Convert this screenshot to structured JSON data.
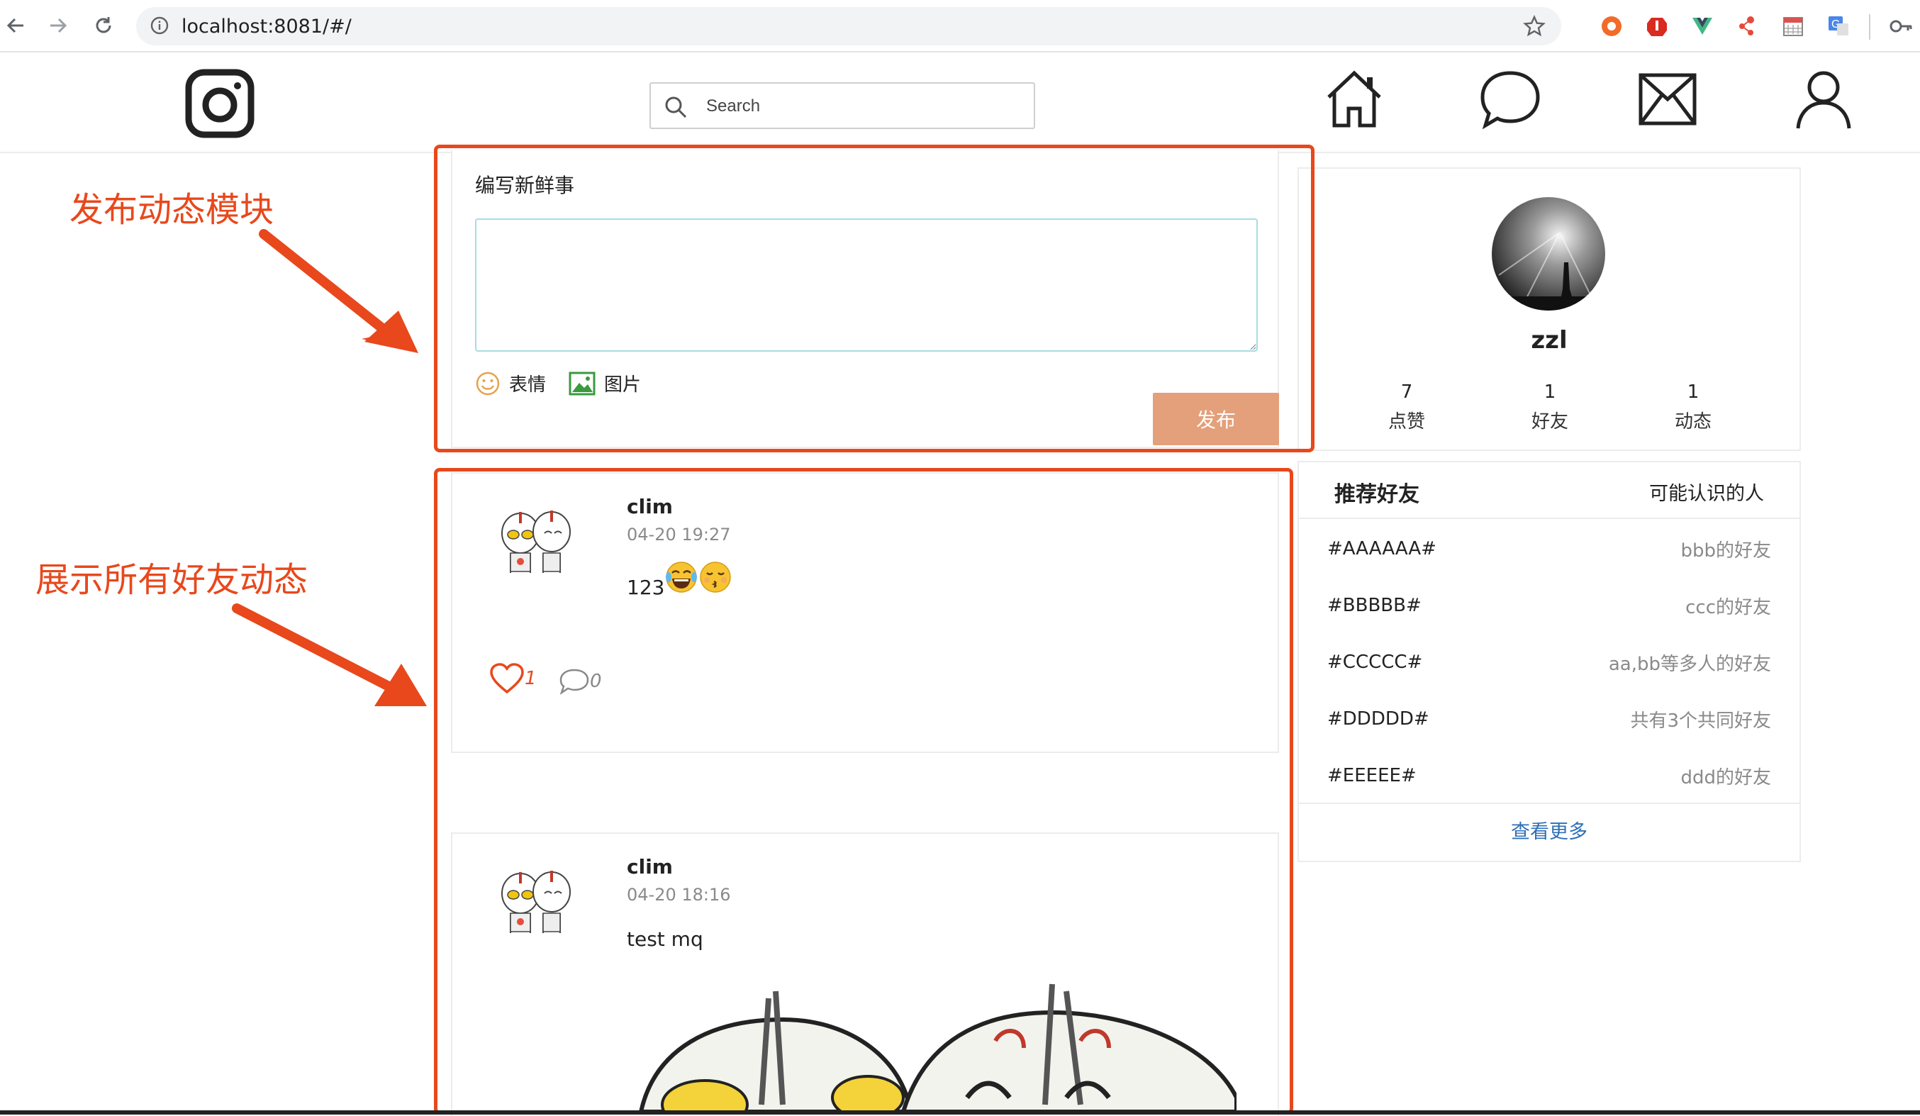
{
  "browser": {
    "url": "localhost:8081/#/"
  },
  "header": {
    "search_placeholder": "Search"
  },
  "annotations": {
    "composer_label": "发布动态模块",
    "feed_label": "展示所有好友动态",
    "color": "#e8481c"
  },
  "composer": {
    "title": "编写新鲜事",
    "text_value": "",
    "emoji_label": "表情",
    "image_label": "图片",
    "publish_label": "发布"
  },
  "posts": [
    {
      "author": "clim",
      "time": "04-20 19:27",
      "text": "123",
      "emojis": [
        "laughing-tears-emoji",
        "kissing-emoji"
      ],
      "likes": "1",
      "comments": "0"
    },
    {
      "author": "clim",
      "time": "04-20 18:16",
      "text": "test mq",
      "has_image": true
    }
  ],
  "profile": {
    "name": "zzl",
    "stats": [
      {
        "num": "7",
        "label": "点赞"
      },
      {
        "num": "1",
        "label": "好友"
      },
      {
        "num": "1",
        "label": "动态"
      }
    ]
  },
  "friends": {
    "title": "推荐好友",
    "subtitle": "可能认识的人",
    "items": [
      {
        "name": "#AAAAAA#",
        "desc": "bbb的好友"
      },
      {
        "name": "#BBBBB#",
        "desc": "ccc的好友"
      },
      {
        "name": "#CCCCC#",
        "desc": "aa,bb等多人的好友"
      },
      {
        "name": "#DDDDD#",
        "desc": "共有3个共同好友"
      },
      {
        "name": "#EEEEE#",
        "desc": "ddd的好友"
      }
    ],
    "more_label": "查看更多"
  },
  "colors": {
    "publish_button": "#e4a07a",
    "like": "#e8481c",
    "link": "#2e6fb8"
  }
}
